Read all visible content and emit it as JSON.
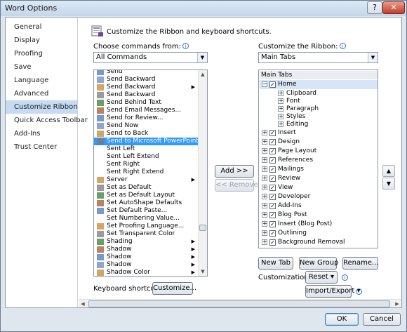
{
  "window": {
    "title": "Word Options",
    "help": "?",
    "close": "✕"
  },
  "sidebar": {
    "items": [
      "General",
      "Display",
      "Proofing",
      "Save",
      "Language",
      "Advanced",
      "Customize Ribbon",
      "Quick Access Toolbar",
      "Add-Ins",
      "Trust Center"
    ],
    "selected": "Customize Ribbon"
  },
  "header": {
    "text": "Customize the Ribbon and keyboard shortcuts."
  },
  "left": {
    "label": "Choose commands from:",
    "combo_value": "All Commands",
    "commands": [
      {
        "label": "Send",
        "sub": false
      },
      {
        "label": "Send Backward",
        "sub": false
      },
      {
        "label": "Send Backward",
        "sub": true
      },
      {
        "label": "Send Backward",
        "sub": false
      },
      {
        "label": "Send Behind Text",
        "sub": false
      },
      {
        "label": "Send Email Messages...",
        "sub": false
      },
      {
        "label": "Send for Review...",
        "sub": false
      },
      {
        "label": "Send Now",
        "sub": false
      },
      {
        "label": "Send to Back",
        "sub": false
      },
      {
        "label": "Send to Microsoft PowerPoint",
        "sub": false
      },
      {
        "label": "Sent Left",
        "sub": false
      },
      {
        "label": "Sent Left Extend",
        "sub": false
      },
      {
        "label": "Sent Right",
        "sub": false
      },
      {
        "label": "Sent Right Extend",
        "sub": false
      },
      {
        "label": "Server",
        "sub": true
      },
      {
        "label": "Set as Default",
        "sub": false
      },
      {
        "label": "Set as Default Layout",
        "sub": false
      },
      {
        "label": "Set AutoShape Defaults",
        "sub": false
      },
      {
        "label": "Set Default Paste...",
        "sub": false
      },
      {
        "label": "Set Numbering Value...",
        "sub": false
      },
      {
        "label": "Set Proofing Language...",
        "sub": false
      },
      {
        "label": "Set Transparent Color",
        "sub": false
      },
      {
        "label": "Shading",
        "sub": true
      },
      {
        "label": "Shadow",
        "sub": true
      },
      {
        "label": "Shadow",
        "sub": true
      },
      {
        "label": "Shadow",
        "sub": true
      },
      {
        "label": "Shadow Color",
        "sub": true
      }
    ],
    "selected": "Send to Microsoft PowerPoint"
  },
  "middle": {
    "add": "Add >>",
    "remove": "<< Remove"
  },
  "right": {
    "label": "Customize the Ribbon:",
    "combo_value": "Main Tabs",
    "tree_header": "Main Tabs",
    "home": "Home",
    "home_children": [
      "Clipboard",
      "Font",
      "Paragraph",
      "Styles",
      "Editing"
    ],
    "tabs": [
      "Insert",
      "Design",
      "Page Layout",
      "References",
      "Mailings",
      "Review",
      "View",
      "Developer",
      "Add-Ins",
      "Blog Post",
      "Insert (Blog Post)",
      "Outlining",
      "Background Removal"
    ]
  },
  "actions": {
    "new_tab": "New Tab",
    "new_group": "New Group",
    "rename": "Rename...",
    "customizations_label": "Customizations:",
    "reset": "Reset ▾",
    "import_export": "Import/Export ▾"
  },
  "keyboard": {
    "label": "Keyboard shortcuts:",
    "customize": "Customize..."
  },
  "footer": {
    "ok": "OK",
    "cancel": "Cancel"
  }
}
